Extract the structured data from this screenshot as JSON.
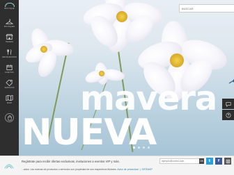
{
  "sidebar": {
    "logo_text": "BOUTIQUE",
    "items": [
      {
        "icon": "hanger-icon",
        "label": "BOUTIQUES"
      },
      {
        "icon": "store-icon",
        "label": "TIENDAS"
      },
      {
        "icon": "fork-knife-icon",
        "label": "RESTAURANTES"
      },
      {
        "icon": "calendar-icon",
        "label": "EVENTOS"
      },
      {
        "icon": "tag-icon",
        "label": "SERVICIOS"
      },
      {
        "icon": "map-icon",
        "label": "MAPA"
      }
    ]
  },
  "search": {
    "placeholder": "BUSCAR"
  },
  "hero": {
    "line1": "mavera",
    "line2": "NUEVA",
    "slides": 4,
    "active_slide": 1
  },
  "footer": {
    "newsletter_text": "Regístrate para recibir ofertas exclusivas, invitaciones a eventos VIP y más.",
    "email_placeholder": "ejemplo@correo.com",
    "ok_label": "OK",
    "legal_text": "...ados. Las marcas de productos o servicios son propiedad de sus respectivos titulares.",
    "privacy_link": "Aviso de privacidad",
    "extra_link": "SITEMAP"
  },
  "social": [
    {
      "icon": "twitter-icon",
      "color": "#2aa0d8"
    },
    {
      "icon": "facebook-icon",
      "color": "#3b5a9a"
    },
    {
      "icon": "instagram-icon",
      "color": "#555555"
    }
  ]
}
